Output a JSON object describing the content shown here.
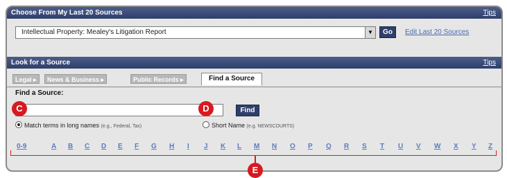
{
  "recent_sources": {
    "header": "Choose From My Last 20 Sources",
    "tips": "Tips",
    "selected_source": "Intellectual Property: Mealey's Litigation Report",
    "go_label": "Go",
    "edit_link": "Edit Last 20 Sources"
  },
  "look_for_source": {
    "header": "Look for a Source",
    "tips": "Tips",
    "tabs": [
      {
        "label": "Legal ▸"
      },
      {
        "label": "News & Business ▸"
      },
      {
        "label": "Public Records ▸"
      },
      {
        "label": "Find a Source",
        "active": true
      }
    ],
    "find_label": "Find a Source:",
    "search_value": "",
    "find_button": "Find",
    "radio_match": {
      "label": "Match terms in long names",
      "hint": "(e.g., Federal, Tax)",
      "checked": true
    },
    "radio_short": {
      "label": "Short Name",
      "hint": "(e.g. NEWSCOURTS)",
      "checked": false
    },
    "alphabet": [
      "0-9",
      "A",
      "B",
      "C",
      "D",
      "E",
      "F",
      "G",
      "H",
      "I",
      "J",
      "K",
      "L",
      "M",
      "N",
      "O",
      "P",
      "Q",
      "R",
      "S",
      "T",
      "U",
      "V",
      "W",
      "X",
      "Y",
      "Z"
    ]
  },
  "callouts": {
    "c": "C",
    "d": "D",
    "e": "E"
  },
  "colors": {
    "header_bg": "#2f3f6b",
    "link": "#5b7bbf",
    "callout": "#d71920"
  }
}
